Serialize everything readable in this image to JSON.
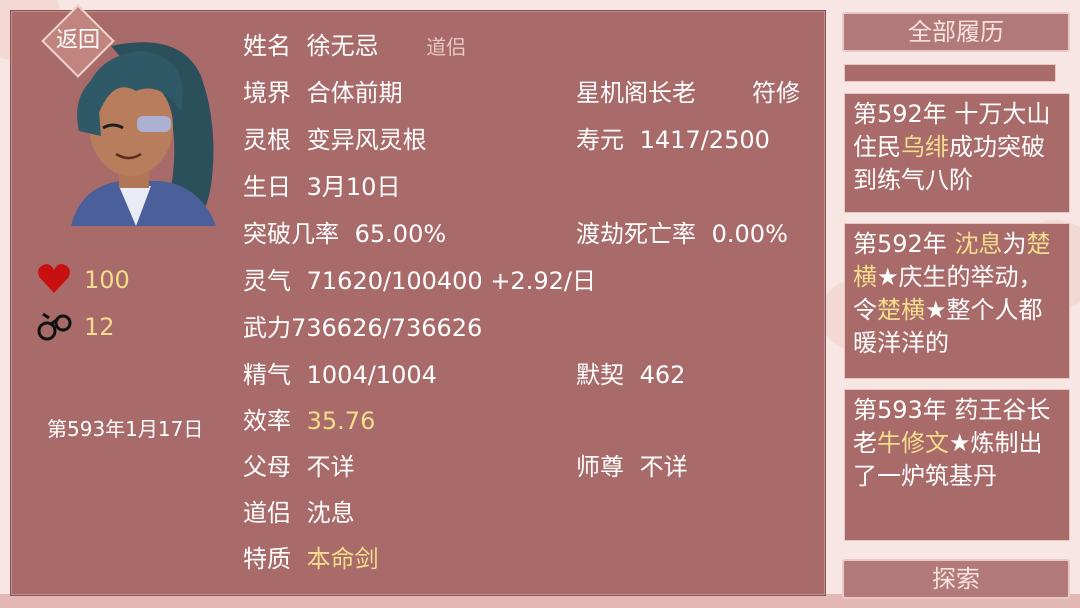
{
  "header": {
    "back_label": "返回"
  },
  "character": {
    "name_label": "姓名",
    "name": "徐无忌",
    "partner_tag": "道侣",
    "realm_label": "境界",
    "realm": "合体前期",
    "sect_title": "星机阁长老",
    "profession": "符修",
    "root_label": "灵根",
    "root": "变异风灵根",
    "life_label": "寿元",
    "life": "1417/2500",
    "birthday_label": "生日",
    "birthday": "3月10日",
    "breakthrough_label": "突破几率",
    "breakthrough": "65.00%",
    "tribulation_label": "渡劫死亡率",
    "tribulation": "0.00%",
    "qi_label": "灵气",
    "qi": "71620/100400 +2.92/日",
    "force_label": "武力",
    "force": "736626/736626",
    "essence_label": "精气",
    "essence": "1004/1004",
    "rapport_label": "默契",
    "rapport": "462",
    "efficiency_label": "效率",
    "efficiency": "35.76",
    "parents_label": "父母",
    "parents": "不详",
    "master_label": "师尊",
    "master": "不详",
    "partner_label": "道侣",
    "partner": "沈息",
    "trait_label": "特质",
    "trait": "本命剑"
  },
  "side_stats": {
    "hearts": "100",
    "bonds": "12"
  },
  "date": "第593年1月17日",
  "right_panel": {
    "all_history_label": "全部履历",
    "explore_label": "探索",
    "events": [
      {
        "pre": "第592年 十万大山住民",
        "hl1": "乌绯",
        "mid": "成功突破到练气八阶",
        "hl2": "",
        "post": ""
      },
      {
        "pre": "第592年 ",
        "hl1": "沈息",
        "mid": "为",
        "hl2": "楚横",
        "post": "★庆生的举动，令",
        "hl3": "楚横",
        "post2": "★整个人都暖洋洋的"
      },
      {
        "pre": "第593年 药王谷长老",
        "hl1": "牛修文",
        "mid": "★炼制出了一炉筑基丹",
        "hl2": "",
        "post": ""
      }
    ]
  },
  "colors": {
    "panel_bg": "#a96a6a",
    "highlight_gold": "#f3dc8c",
    "page_bg": "#f7e6e3"
  }
}
